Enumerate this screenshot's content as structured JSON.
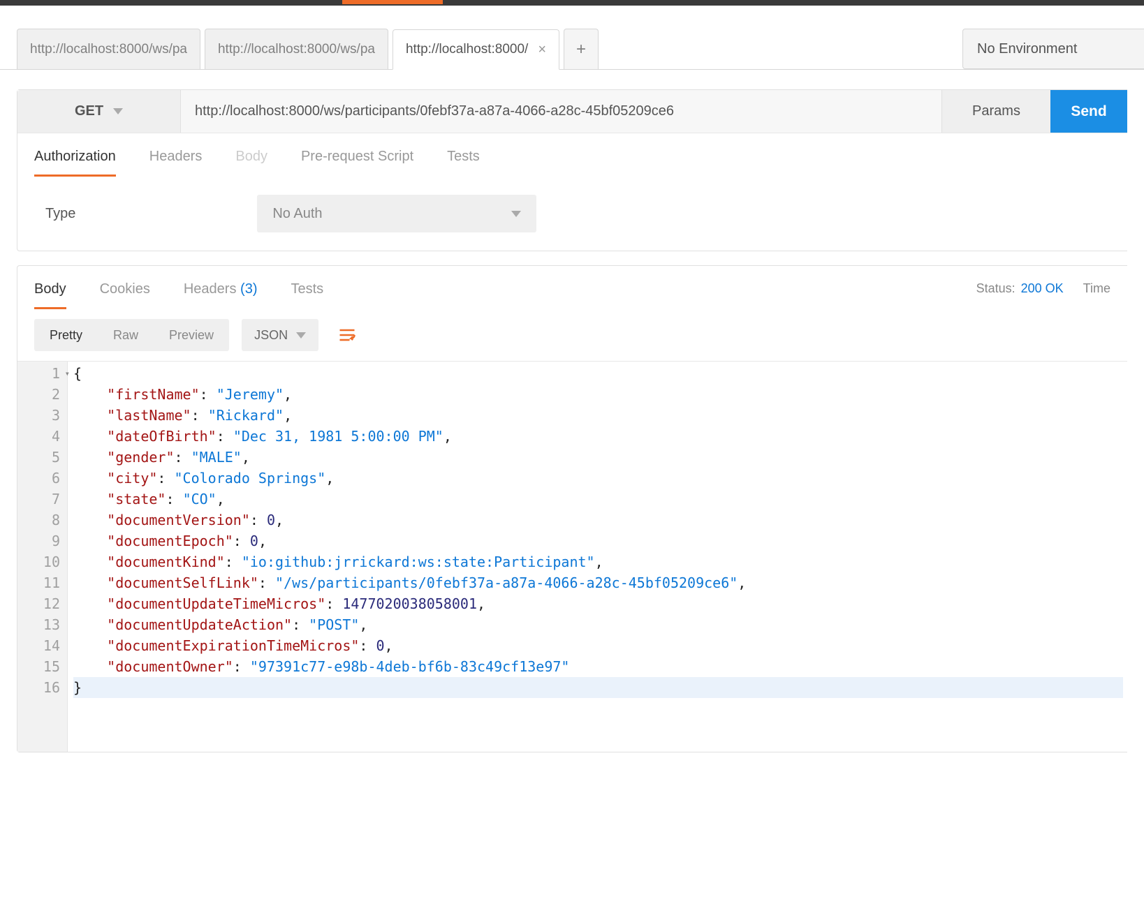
{
  "env": {
    "label": "No Environment"
  },
  "tabs": [
    {
      "label": "http://localhost:8000/ws/pa"
    },
    {
      "label": "http://localhost:8000/ws/pa"
    },
    {
      "label": "http://localhost:8000/",
      "active": true
    }
  ],
  "addTab": "+",
  "request": {
    "method": "GET",
    "url": "http://localhost:8000/ws/participants/0febf37a-a87a-4066-a28c-45bf05209ce6",
    "paramsBtn": "Params",
    "sendBtn": "Send",
    "tabs": {
      "authorization": "Authorization",
      "headers": "Headers",
      "body": "Body",
      "prerequest": "Pre-request Script",
      "tests": "Tests"
    },
    "auth": {
      "label": "Type",
      "value": "No Auth"
    }
  },
  "response": {
    "tabs": {
      "body": "Body",
      "cookies": "Cookies",
      "headers": "Headers",
      "headersCount": "(3)",
      "tests": "Tests"
    },
    "statusLabel": "Status:",
    "statusCode": "200 OK",
    "timeLabel": "Time",
    "format": {
      "pretty": "Pretty",
      "raw": "Raw",
      "preview": "Preview",
      "type": "JSON"
    },
    "lineNumbers": [
      "1",
      "2",
      "3",
      "4",
      "5",
      "6",
      "7",
      "8",
      "9",
      "10",
      "11",
      "12",
      "13",
      "14",
      "15",
      "16"
    ],
    "json": {
      "firstName": "Jeremy",
      "lastName": "Rickard",
      "dateOfBirth": "Dec 31, 1981 5:00:00 PM",
      "gender": "MALE",
      "city": "Colorado Springs",
      "state": "CO",
      "documentVersion": 0,
      "documentEpoch": 0,
      "documentKind": "io:github:jrrickard:ws:state:Participant",
      "documentSelfLink": "/ws/participants/0febf37a-a87a-4066-a28c-45bf05209ce6",
      "documentUpdateTimeMicros": 1477020038058001,
      "documentUpdateAction": "POST",
      "documentExpirationTimeMicros": 0,
      "documentOwner": "97391c77-e98b-4deb-bf6b-83c49cf13e97"
    }
  }
}
